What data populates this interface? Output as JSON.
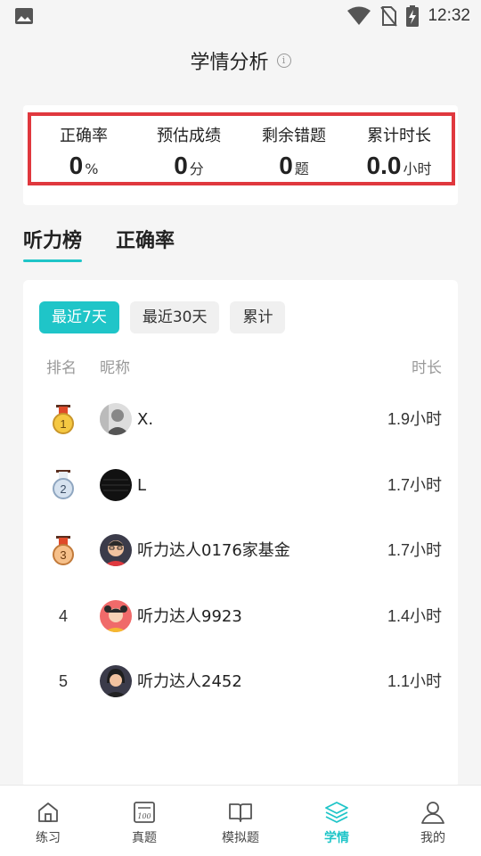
{
  "status_bar": {
    "time": "12:32"
  },
  "header": {
    "title": "学情分析",
    "info_icon": "info-icon"
  },
  "stats": [
    {
      "label": "正确率",
      "value": "0",
      "unit": "%"
    },
    {
      "label": "预估成绩",
      "value": "0",
      "unit": "分"
    },
    {
      "label": "剩余错题",
      "value": "0",
      "unit": "题"
    },
    {
      "label": "累计时长",
      "value": "0.0",
      "unit": "小时"
    }
  ],
  "tabs": [
    {
      "label": "听力榜",
      "active": true
    },
    {
      "label": "正确率",
      "active": false
    }
  ],
  "filters": [
    {
      "label": "最近7天",
      "active": true
    },
    {
      "label": "最近30天",
      "active": false
    },
    {
      "label": "累计",
      "active": false
    }
  ],
  "columns": {
    "rank": "排名",
    "nickname": "昵称",
    "duration": "时长"
  },
  "rankings": [
    {
      "rank": "1",
      "medal": "gold-medal-icon",
      "nickname": "X.",
      "hours": "1.9",
      "unit": "小时"
    },
    {
      "rank": "2",
      "medal": "silver-medal-icon",
      "nickname": "L",
      "hours": "1.7",
      "unit": "小时"
    },
    {
      "rank": "3",
      "medal": "bronze-medal-icon",
      "nickname": "听力达人0176家基金",
      "hours": "1.7",
      "unit": "小时"
    },
    {
      "rank": "4",
      "nickname": "听力达人9923",
      "hours": "1.4",
      "unit": "小时"
    },
    {
      "rank": "5",
      "nickname": "听力达人2452",
      "hours": "1.1",
      "unit": "小时"
    }
  ],
  "bottom_nav": [
    {
      "label": "练习",
      "icon": "home-icon",
      "active": false
    },
    {
      "label": "真题",
      "icon": "exam-paper-icon",
      "active": false
    },
    {
      "label": "模拟题",
      "icon": "book-icon",
      "active": false
    },
    {
      "label": "学情",
      "icon": "layers-icon",
      "active": true
    },
    {
      "label": "我的",
      "icon": "profile-icon",
      "active": false
    }
  ],
  "colors": {
    "accent": "#1fc5c8",
    "highlight_border": "#e0383e",
    "muted": "#999999"
  }
}
